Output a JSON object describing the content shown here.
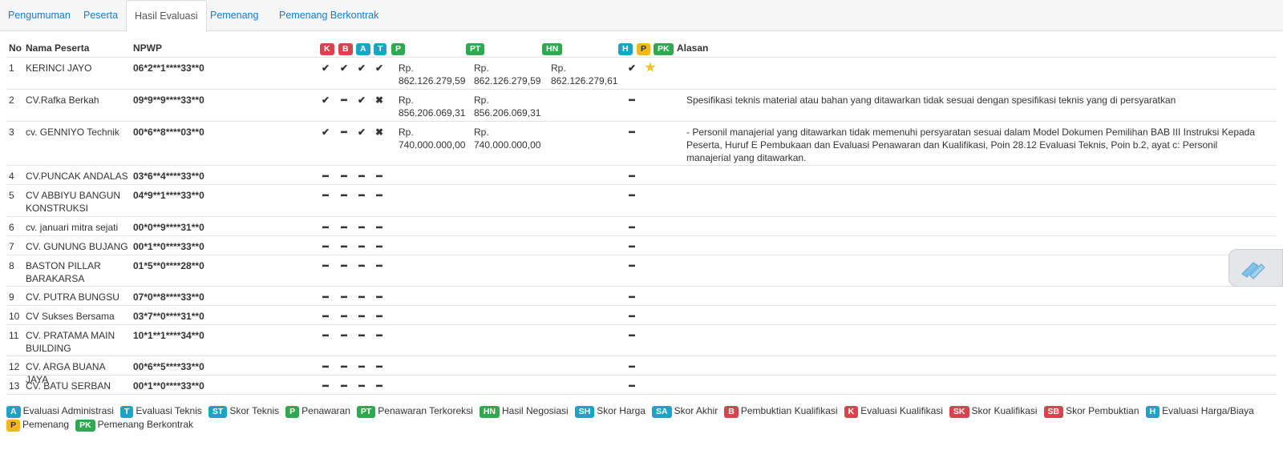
{
  "tabs": [
    "Pengumuman",
    "Peserta",
    "Hasil Evaluasi",
    "Pemenang",
    "Pemenang Berkontrak"
  ],
  "header": {
    "no": "No",
    "nama": "Nama Peserta",
    "npwp": "NPWP",
    "badge_k": "K",
    "badge_b": "B",
    "badge_a": "A",
    "badge_t": "T",
    "badge_p": "P",
    "badge_pt": "PT",
    "badge_hn": "HN",
    "badge_h": "H",
    "badge_pm": "P",
    "badge_pk": "PK",
    "alasan": "Alasan"
  },
  "rows": [
    {
      "no": "1",
      "nama": "KERINCI JAYO",
      "npwp": "06*2**1****33**0",
      "k": "✔",
      "b": "✔",
      "a": "✔",
      "t": "✔",
      "p": "Rp. 862.126.279,59",
      "pt": "Rp. 862.126.279,59",
      "hn": "Rp. 862.126.279,61",
      "h": "✔",
      "pm": "★",
      "alasan": ""
    },
    {
      "no": "2",
      "nama": "CV.Rafka Berkah",
      "npwp": "09*9**9****33**0",
      "k": "✔",
      "b": "━",
      "a": "✔",
      "t": "✖",
      "p": "Rp. 856.206.069,31",
      "pt": "Rp. 856.206.069,31",
      "hn": "",
      "h": "━",
      "pm": "",
      "alasan": "Spesifikasi teknis material atau bahan yang ditawarkan tidak sesuai dengan spesifikasi teknis yang di persyaratkan"
    },
    {
      "no": "3",
      "nama": "cv. GENNIYO Technik",
      "npwp": "00*6**8****03**0",
      "k": "✔",
      "b": "━",
      "a": "✔",
      "t": "✖",
      "p": "Rp. 740.000.000,00",
      "pt": "Rp. 740.000.000,00",
      "hn": "",
      "h": "━",
      "pm": "",
      "alasan": "- Personil manajerial yang ditawarkan tidak memenuhi persyaratan sesuai dalam Model Dokumen Pemilihan BAB III Instruksi Kepada Peserta, Huruf E Pembukaan dan Evaluasi Penawaran dan Kualifikasi, Poin 28.12 Evaluasi Teknis, Poin b.2, ayat c: Personil manajerial yang ditawarkan."
    },
    {
      "no": "4",
      "nama": "CV.PUNCAK ANDALAS",
      "npwp": "03*6**4****33**0",
      "k": "━",
      "b": "━",
      "a": "━",
      "t": "━",
      "p": "",
      "pt": "",
      "hn": "",
      "h": "━",
      "pm": "",
      "alasan": ""
    },
    {
      "no": "5",
      "nama": "CV ABBIYU BANGUN KONSTRUKSI",
      "npwp": "04*9**1****33**0",
      "k": "━",
      "b": "━",
      "a": "━",
      "t": "━",
      "p": "",
      "pt": "",
      "hn": "",
      "h": "━",
      "pm": "",
      "alasan": ""
    },
    {
      "no": "6",
      "nama": "cv. januari mitra sejati",
      "npwp": "00*0**9****31**0",
      "k": "━",
      "b": "━",
      "a": "━",
      "t": "━",
      "p": "",
      "pt": "",
      "hn": "",
      "h": "━",
      "pm": "",
      "alasan": ""
    },
    {
      "no": "7",
      "nama": "CV. GUNUNG BUJANG",
      "npwp": "00*1**0****33**0",
      "k": "━",
      "b": "━",
      "a": "━",
      "t": "━",
      "p": "",
      "pt": "",
      "hn": "",
      "h": "━",
      "pm": "",
      "alasan": ""
    },
    {
      "no": "8",
      "nama": "BASTON PILLAR BARAKARSA",
      "npwp": "01*5**0****28**0",
      "k": "━",
      "b": "━",
      "a": "━",
      "t": "━",
      "p": "",
      "pt": "",
      "hn": "",
      "h": "━",
      "pm": "",
      "alasan": ""
    },
    {
      "no": "9",
      "nama": "CV. PUTRA BUNGSU",
      "npwp": "07*0**8****33**0",
      "k": "━",
      "b": "━",
      "a": "━",
      "t": "━",
      "p": "",
      "pt": "",
      "hn": "",
      "h": "━",
      "pm": "",
      "alasan": ""
    },
    {
      "no": "10",
      "nama": "CV Sukses Bersama",
      "npwp": "03*7**0****31**0",
      "k": "━",
      "b": "━",
      "a": "━",
      "t": "━",
      "p": "",
      "pt": "",
      "hn": "",
      "h": "━",
      "pm": "",
      "alasan": ""
    },
    {
      "no": "11",
      "nama": "CV. PRATAMA MAIN BUILDING",
      "npwp": "10*1**1****34**0",
      "k": "━",
      "b": "━",
      "a": "━",
      "t": "━",
      "p": "",
      "pt": "",
      "hn": "",
      "h": "━",
      "pm": "",
      "alasan": ""
    },
    {
      "no": "12",
      "nama": "CV. ARGA BUANA JAYA",
      "npwp": "00*6**5****33**0",
      "k": "━",
      "b": "━",
      "a": "━",
      "t": "━",
      "p": "",
      "pt": "",
      "hn": "",
      "h": "━",
      "pm": "",
      "alasan": ""
    },
    {
      "no": "13",
      "nama": "CV. BATU SERBAN",
      "npwp": "00*1**0****33**0",
      "k": "━",
      "b": "━",
      "a": "━",
      "t": "━",
      "p": "",
      "pt": "",
      "hn": "",
      "h": "━",
      "pm": "",
      "alasan": ""
    }
  ],
  "legend": [
    {
      "code": "A",
      "color": "teal",
      "label": "Evaluasi Administrasi"
    },
    {
      "code": "T",
      "color": "teal",
      "label": "Evaluasi Teknis"
    },
    {
      "code": "ST",
      "color": "teal",
      "label": "Skor Teknis"
    },
    {
      "code": "P",
      "color": "green",
      "label": "Penawaran"
    },
    {
      "code": "PT",
      "color": "green",
      "label": "Penawaran Terkoreksi"
    },
    {
      "code": "HN",
      "color": "green",
      "label": "Hasil Negosiasi"
    },
    {
      "code": "SH",
      "color": "teal",
      "label": "Skor Harga"
    },
    {
      "code": "SA",
      "color": "teal",
      "label": "Skor Akhir"
    },
    {
      "code": "B",
      "color": "red",
      "label": "Pembuktian Kualifikasi"
    },
    {
      "code": "K",
      "color": "red",
      "label": "Evaluasi Kualifikasi"
    },
    {
      "code": "SK",
      "color": "red",
      "label": "Skor Kualifikasi"
    },
    {
      "code": "SB",
      "color": "red",
      "label": "Skor Pembuktian"
    },
    {
      "code": "H",
      "color": "teal",
      "label": "Evaluasi Harga/Biaya"
    },
    {
      "code": "P",
      "color": "yellow",
      "label": "Pemenang"
    },
    {
      "code": "PK",
      "color": "green",
      "label": "Pemenang Berkontrak"
    }
  ],
  "colors": {
    "red": "#d9434e",
    "teal": "#1fa3c4",
    "green": "#2fa84f",
    "yellow": "#f0b720",
    "link": "#1a7cc8"
  },
  "icons": {
    "check": "check-icon",
    "dash": "dash-icon",
    "cross": "cross-icon",
    "star": "star-icon",
    "floater": "pencil-icon"
  }
}
